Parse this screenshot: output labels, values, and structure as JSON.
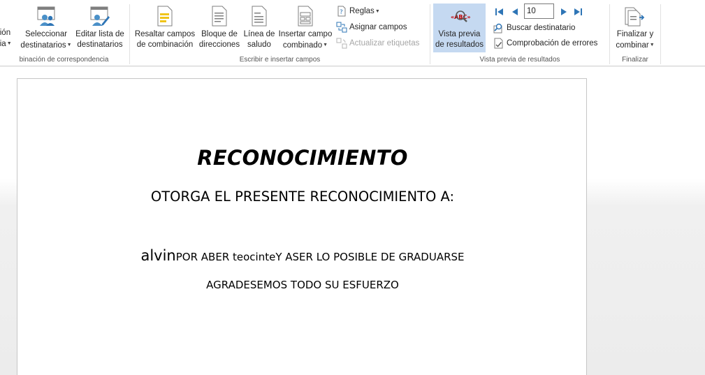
{
  "ribbon": {
    "groups": {
      "start": {
        "label": "binación de correspondencia",
        "buttons": {
          "truncated_line1": "ción",
          "truncated_line2": "cia",
          "select_recipients_line1": "Seleccionar",
          "select_recipients_line2": "destinatarios",
          "edit_list_line1": "Editar lista de",
          "edit_list_line2": "destinatarios"
        }
      },
      "write_insert": {
        "label": "Escribir e insertar campos",
        "buttons": {
          "highlight_line1": "Resaltar campos",
          "highlight_line2": "de combinación",
          "address_line1": "Bloque de",
          "address_line2": "direcciones",
          "greeting_line1": "Línea de",
          "greeting_line2": "saludo",
          "insert_field_line1": "Insertar campo",
          "insert_field_line2": "combinado",
          "rules": "Reglas",
          "match_fields": "Asignar campos",
          "update_labels": "Actualizar etiquetas"
        }
      },
      "preview": {
        "label": "Vista previa de resultados",
        "buttons": {
          "preview_line1": "Vista previa",
          "preview_line2": "de resultados",
          "record_number": "10",
          "find_recipient": "Buscar destinatario",
          "check_errors": "Comprobación de errores"
        }
      },
      "finish": {
        "label": "Finalizar",
        "buttons": {
          "finish_line1": "Finalizar y",
          "finish_line2": "combinar"
        }
      }
    },
    "colors": {
      "accent": "#2b579a",
      "active_button": "#c5d9f1"
    }
  },
  "document": {
    "title": "RECONOCIMIENTO",
    "subtitle": "OTORGA EL PRESENTE RECONOCIMIENTO A:",
    "merge_name": "alvin",
    "text_part1": "POR ABER teocinte",
    "text_part2": "Y ASER LO POSIBLE DE GRADUARSE",
    "thanks": "AGRADESEMOS TODO SU ESFUERZO"
  }
}
